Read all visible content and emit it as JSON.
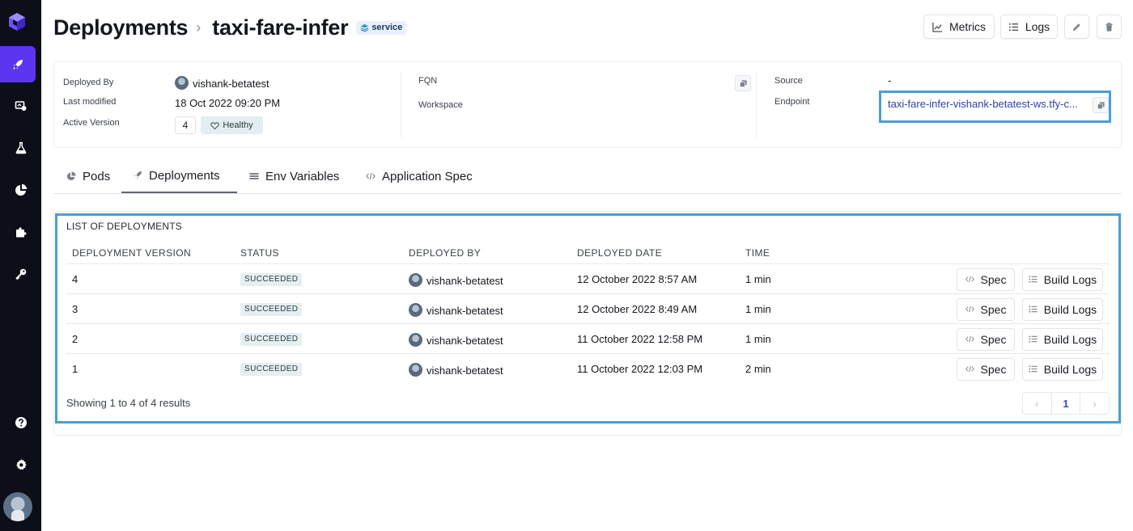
{
  "colors": {
    "sidebar_bg": "#0c0f17",
    "accent": "#5b35ef",
    "highlight_box": "#4a9fd2",
    "link": "#2e3fa8"
  },
  "sidebar": {
    "items": [
      {
        "icon": "rocket-icon",
        "active": true
      },
      {
        "icon": "models-icon",
        "active": false
      },
      {
        "icon": "flask-icon",
        "active": false
      },
      {
        "icon": "pie-chart-icon",
        "active": false
      },
      {
        "icon": "puzzle-icon",
        "active": false
      },
      {
        "icon": "key-icon",
        "active": false
      },
      {
        "icon": "help-icon",
        "active": false
      },
      {
        "icon": "settings-icon",
        "active": false
      }
    ]
  },
  "header": {
    "breadcrumb_root": "Deployments",
    "separator": "›",
    "title": "taxi-fare-infer",
    "type_badge": "service",
    "metrics_label": "Metrics",
    "logs_label": "Logs"
  },
  "info": {
    "deployed_by_label": "Deployed By",
    "deployed_by": "vishank-betatest",
    "last_modified_label": "Last modified",
    "last_modified": "18 Oct 2022 09:20 PM",
    "active_version_label": "Active Version",
    "active_version": "4",
    "health": "Healthy",
    "fqn_label": "FQN",
    "workspace_label": "Workspace",
    "source_label": "Source",
    "source": "-",
    "endpoint_label": "Endpoint",
    "endpoint": "taxi-fare-infer-vishank-betatest-ws.tfy-c..."
  },
  "tabs": [
    {
      "label": "Pods",
      "icon": "pie-chart-icon"
    },
    {
      "label": "Deployments",
      "icon": "rocket-icon",
      "active": true
    },
    {
      "label": "Env Variables",
      "icon": "list-icon"
    },
    {
      "label": "Application Spec",
      "icon": "code-icon"
    }
  ],
  "deployments": {
    "title": "LIST OF DEPLOYMENTS",
    "columns": [
      "DEPLOYMENT VERSION",
      "STATUS",
      "DEPLOYED BY",
      "DEPLOYED DATE",
      "TIME"
    ],
    "rows": [
      {
        "version": "4",
        "status": "SUCCEEDED",
        "deployed_by": "vishank-betatest",
        "date": "12 October 2022 8:57 AM",
        "time": "1 min"
      },
      {
        "version": "3",
        "status": "SUCCEEDED",
        "deployed_by": "vishank-betatest",
        "date": "12 October 2022 8:49 AM",
        "time": "1 min"
      },
      {
        "version": "2",
        "status": "SUCCEEDED",
        "deployed_by": "vishank-betatest",
        "date": "11 October 2022 12:58 PM",
        "time": "1 min"
      },
      {
        "version": "1",
        "status": "SUCCEEDED",
        "deployed_by": "vishank-betatest",
        "date": "11 October 2022 12:03 PM",
        "time": "2 min"
      }
    ],
    "spec_label": "Spec",
    "build_logs_label": "Build Logs",
    "footer": "Showing 1 to 4 of 4 results",
    "pager": {
      "prev": "‹",
      "current": "1",
      "next": "›"
    }
  }
}
